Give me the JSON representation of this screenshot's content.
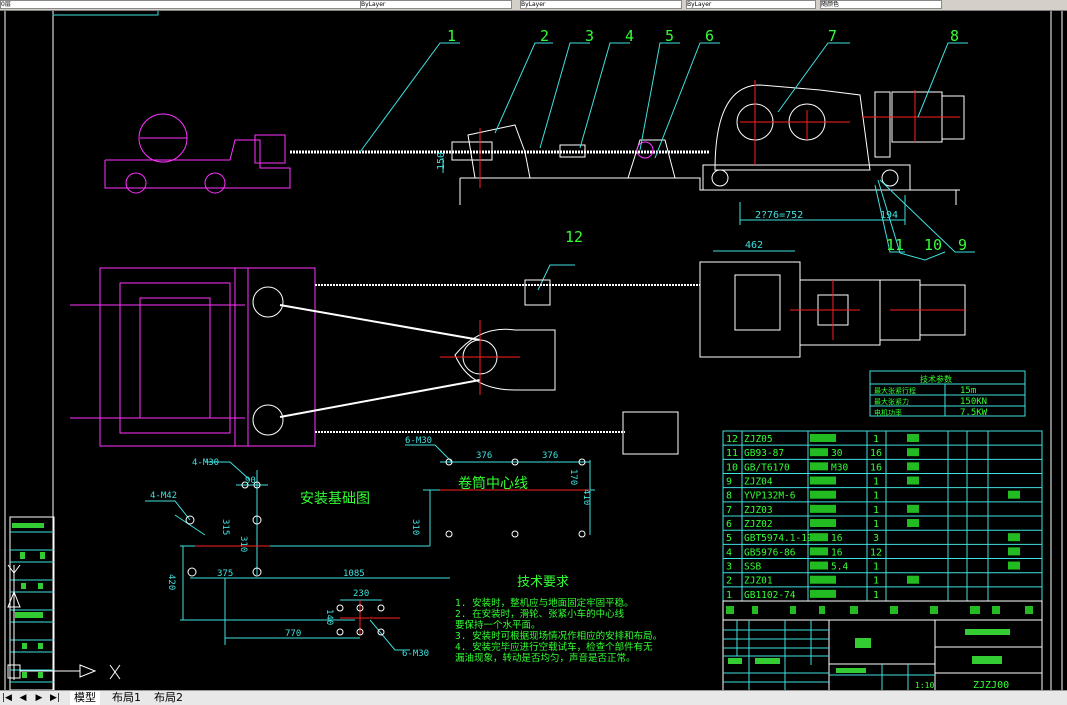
{
  "toolbar": {
    "layer_value": "0层",
    "linetype_1": "ByLayer",
    "linetype_2": "ByLayer",
    "lineweight": "ByLayer",
    "plotstyle": "随颜色"
  },
  "tabs": [
    "模型",
    "布局1",
    "布局2"
  ],
  "drawing": {
    "balloons": [
      "1",
      "2",
      "3",
      "4",
      "5",
      "6",
      "7",
      "8",
      "9",
      "10",
      "11",
      "12"
    ],
    "dims_top": {
      "height_150": "150",
      "dim_2776": "2?76=752",
      "dim_194": "194",
      "dim_462": "462"
    },
    "foundation": {
      "title": "安装基础图",
      "drum_centerline": "卷筒中心线",
      "labels": [
        "4-M30",
        "4-M42",
        "6-M30",
        "6-M30"
      ],
      "dims": {
        "d90": "90",
        "d315": "315",
        "d310": "310",
        "d310b": "310",
        "d375": "375",
        "d1085": "1085",
        "d420": "420",
        "d376a": "376",
        "d376b": "376",
        "d170": "170",
        "d410": "410",
        "d230": "230",
        "d140": "140",
        "d770": "770"
      }
    },
    "tech_requirements": {
      "title": "技术要求",
      "lines": [
        "1. 安装时，整机应与地面固定牢固平稳。",
        "2. 在安装时，滑轮、张紧小车的中心线",
        "   要保持一个水平面。",
        "3. 安装时可根据现场情况作相应的安排和布局。",
        "4. 安装完毕应进行空载试车，检查个部件有无",
        "   漏油现象，转动是否均匀，声音是否正常。"
      ]
    },
    "tech_params": {
      "title": "技术参数",
      "rows": [
        {
          "label": "最大张紧行程",
          "value": "15m"
        },
        {
          "label": "最大张紧力",
          "value": "150KN"
        },
        {
          "label": "电机功率",
          "value": "7.5KW"
        }
      ]
    },
    "parts": [
      {
        "no": "12",
        "code": "ZJZ05",
        "qty": "1"
      },
      {
        "no": "11",
        "code": "GB93-87",
        "spec": "30",
        "qty": "16"
      },
      {
        "no": "10",
        "code": "GB/T6170",
        "spec": "M30",
        "qty": "16"
      },
      {
        "no": "9",
        "code": "ZJZ04",
        "qty": "1"
      },
      {
        "no": "8",
        "code": "YVP132M-6",
        "qty": "1"
      },
      {
        "no": "7",
        "code": "ZJZ03",
        "qty": "1"
      },
      {
        "no": "6",
        "code": "ZJZ02",
        "qty": "1"
      },
      {
        "no": "5",
        "code": "GBT5974.1-1986",
        "spec": "16",
        "qty": "3"
      },
      {
        "no": "4",
        "code": "GB5976-86",
        "spec": "16",
        "qty": "12"
      },
      {
        "no": "3",
        "code": "SSB",
        "spec": "5.4",
        "qty": "1"
      },
      {
        "no": "2",
        "code": "ZJZ01",
        "qty": "1"
      },
      {
        "no": "1",
        "code": "GB1102-74",
        "qty": "1"
      }
    ],
    "title_block": {
      "scale": "1:10",
      "drawing_no": "ZJZJ00"
    }
  },
  "colors": {
    "bg": "#000000",
    "white": "#ffffff",
    "cyan": "#3fe0e0",
    "green": "#33ff33",
    "red": "#ff2020",
    "magenta": "#ff33ff"
  }
}
